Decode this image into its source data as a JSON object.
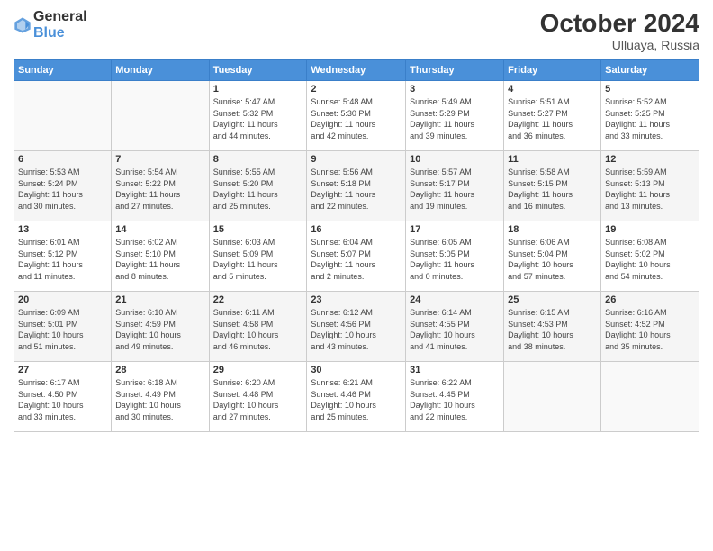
{
  "logo": {
    "general": "General",
    "blue": "Blue"
  },
  "title": "October 2024",
  "location": "Ulluaya, Russia",
  "days_header": [
    "Sunday",
    "Monday",
    "Tuesday",
    "Wednesday",
    "Thursday",
    "Friday",
    "Saturday"
  ],
  "weeks": [
    [
      {
        "day": "",
        "info": ""
      },
      {
        "day": "",
        "info": ""
      },
      {
        "day": "1",
        "info": "Sunrise: 5:47 AM\nSunset: 5:32 PM\nDaylight: 11 hours\nand 44 minutes."
      },
      {
        "day": "2",
        "info": "Sunrise: 5:48 AM\nSunset: 5:30 PM\nDaylight: 11 hours\nand 42 minutes."
      },
      {
        "day": "3",
        "info": "Sunrise: 5:49 AM\nSunset: 5:29 PM\nDaylight: 11 hours\nand 39 minutes."
      },
      {
        "day": "4",
        "info": "Sunrise: 5:51 AM\nSunset: 5:27 PM\nDaylight: 11 hours\nand 36 minutes."
      },
      {
        "day": "5",
        "info": "Sunrise: 5:52 AM\nSunset: 5:25 PM\nDaylight: 11 hours\nand 33 minutes."
      }
    ],
    [
      {
        "day": "6",
        "info": "Sunrise: 5:53 AM\nSunset: 5:24 PM\nDaylight: 11 hours\nand 30 minutes."
      },
      {
        "day": "7",
        "info": "Sunrise: 5:54 AM\nSunset: 5:22 PM\nDaylight: 11 hours\nand 27 minutes."
      },
      {
        "day": "8",
        "info": "Sunrise: 5:55 AM\nSunset: 5:20 PM\nDaylight: 11 hours\nand 25 minutes."
      },
      {
        "day": "9",
        "info": "Sunrise: 5:56 AM\nSunset: 5:18 PM\nDaylight: 11 hours\nand 22 minutes."
      },
      {
        "day": "10",
        "info": "Sunrise: 5:57 AM\nSunset: 5:17 PM\nDaylight: 11 hours\nand 19 minutes."
      },
      {
        "day": "11",
        "info": "Sunrise: 5:58 AM\nSunset: 5:15 PM\nDaylight: 11 hours\nand 16 minutes."
      },
      {
        "day": "12",
        "info": "Sunrise: 5:59 AM\nSunset: 5:13 PM\nDaylight: 11 hours\nand 13 minutes."
      }
    ],
    [
      {
        "day": "13",
        "info": "Sunrise: 6:01 AM\nSunset: 5:12 PM\nDaylight: 11 hours\nand 11 minutes."
      },
      {
        "day": "14",
        "info": "Sunrise: 6:02 AM\nSunset: 5:10 PM\nDaylight: 11 hours\nand 8 minutes."
      },
      {
        "day": "15",
        "info": "Sunrise: 6:03 AM\nSunset: 5:09 PM\nDaylight: 11 hours\nand 5 minutes."
      },
      {
        "day": "16",
        "info": "Sunrise: 6:04 AM\nSunset: 5:07 PM\nDaylight: 11 hours\nand 2 minutes."
      },
      {
        "day": "17",
        "info": "Sunrise: 6:05 AM\nSunset: 5:05 PM\nDaylight: 11 hours\nand 0 minutes."
      },
      {
        "day": "18",
        "info": "Sunrise: 6:06 AM\nSunset: 5:04 PM\nDaylight: 10 hours\nand 57 minutes."
      },
      {
        "day": "19",
        "info": "Sunrise: 6:08 AM\nSunset: 5:02 PM\nDaylight: 10 hours\nand 54 minutes."
      }
    ],
    [
      {
        "day": "20",
        "info": "Sunrise: 6:09 AM\nSunset: 5:01 PM\nDaylight: 10 hours\nand 51 minutes."
      },
      {
        "day": "21",
        "info": "Sunrise: 6:10 AM\nSunset: 4:59 PM\nDaylight: 10 hours\nand 49 minutes."
      },
      {
        "day": "22",
        "info": "Sunrise: 6:11 AM\nSunset: 4:58 PM\nDaylight: 10 hours\nand 46 minutes."
      },
      {
        "day": "23",
        "info": "Sunrise: 6:12 AM\nSunset: 4:56 PM\nDaylight: 10 hours\nand 43 minutes."
      },
      {
        "day": "24",
        "info": "Sunrise: 6:14 AM\nSunset: 4:55 PM\nDaylight: 10 hours\nand 41 minutes."
      },
      {
        "day": "25",
        "info": "Sunrise: 6:15 AM\nSunset: 4:53 PM\nDaylight: 10 hours\nand 38 minutes."
      },
      {
        "day": "26",
        "info": "Sunrise: 6:16 AM\nSunset: 4:52 PM\nDaylight: 10 hours\nand 35 minutes."
      }
    ],
    [
      {
        "day": "27",
        "info": "Sunrise: 6:17 AM\nSunset: 4:50 PM\nDaylight: 10 hours\nand 33 minutes."
      },
      {
        "day": "28",
        "info": "Sunrise: 6:18 AM\nSunset: 4:49 PM\nDaylight: 10 hours\nand 30 minutes."
      },
      {
        "day": "29",
        "info": "Sunrise: 6:20 AM\nSunset: 4:48 PM\nDaylight: 10 hours\nand 27 minutes."
      },
      {
        "day": "30",
        "info": "Sunrise: 6:21 AM\nSunset: 4:46 PM\nDaylight: 10 hours\nand 25 minutes."
      },
      {
        "day": "31",
        "info": "Sunrise: 6:22 AM\nSunset: 4:45 PM\nDaylight: 10 hours\nand 22 minutes."
      },
      {
        "day": "",
        "info": ""
      },
      {
        "day": "",
        "info": ""
      }
    ]
  ]
}
